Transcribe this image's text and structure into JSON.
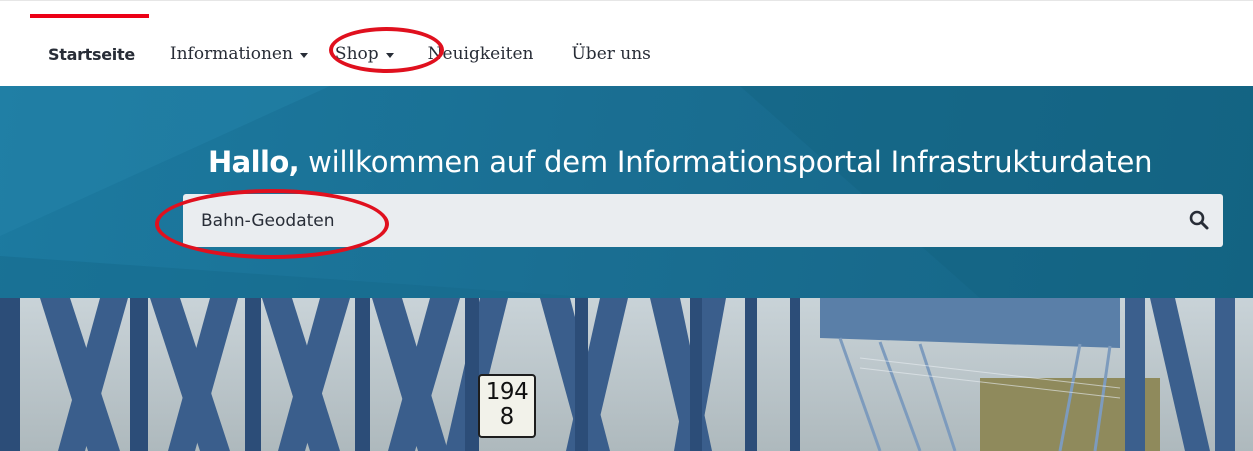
{
  "nav": {
    "items": [
      {
        "label": "Startseite",
        "active": true,
        "dropdown": false
      },
      {
        "label": "Informationen",
        "active": false,
        "dropdown": true
      },
      {
        "label": "Shop",
        "active": false,
        "dropdown": true
      },
      {
        "label": "Neuigkeiten",
        "active": false,
        "dropdown": false
      },
      {
        "label": "Über uns",
        "active": false,
        "dropdown": false
      }
    ]
  },
  "hero": {
    "greeting": "Hallo,",
    "welcome": " willkommen auf dem Informationsportal Infrastrukturdaten",
    "search": {
      "value": "Bahn-Geodaten",
      "icon": "search-icon"
    }
  },
  "photo": {
    "sign_line1": "194",
    "sign_line2": "8"
  },
  "colors": {
    "accent_red": "#ec0016",
    "hero_blue": "#1a6f93",
    "annotation_red": "#e0101e"
  }
}
